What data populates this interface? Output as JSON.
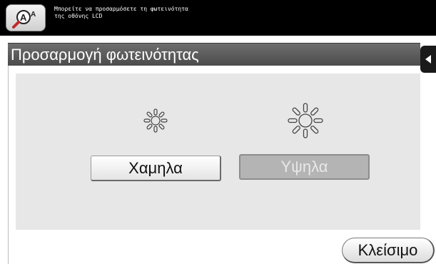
{
  "header": {
    "guide_icon": "guide-magnifier-A-icon",
    "message_line1": "Μπορείτε να προσαρμόσετε τη φωτεινότητα",
    "message_line2": "της οθόνης LCD"
  },
  "title": "Προσαρμογή φωτεινότητας",
  "back_icon": "arrow-left-icon",
  "brightness": {
    "low_icon": "sun-small-icon",
    "high_icon": "sun-large-icon",
    "low_label": "Χαμηλα",
    "high_label": "Υψηλα",
    "selected": "Υψηλα"
  },
  "footer": {
    "close_label": "Κλείσιμο"
  },
  "colors": {
    "topbar": "#000000",
    "titlebar": "#5a5a5a",
    "panel": "#e7e7e7",
    "disabled_button": "#b4b4b4"
  }
}
